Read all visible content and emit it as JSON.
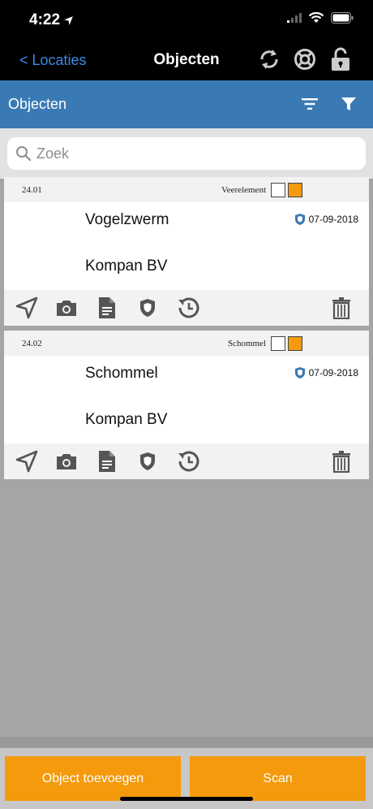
{
  "status_bar": {
    "time": "4:22"
  },
  "nav": {
    "back_label": "< Locaties",
    "title": "Objecten"
  },
  "section": {
    "title": "Objecten"
  },
  "search": {
    "placeholder": "Zoek"
  },
  "items": [
    {
      "code": "24.01",
      "type": "Veerelement",
      "name": "Vogelzwerm",
      "date": "07-09-2018",
      "company": "Kompan BV"
    },
    {
      "code": "24.02",
      "type": "Schommel",
      "name": "Schommel",
      "date": "07-09-2018",
      "company": "Kompan BV"
    }
  ],
  "buttons": {
    "add_object": "Object toevoegen",
    "scan": "Scan"
  },
  "colors": {
    "accent_blue": "#3a7ab4",
    "link_blue": "#3d8ae5",
    "orange": "#f59a0c",
    "icon_gray": "#555555"
  }
}
